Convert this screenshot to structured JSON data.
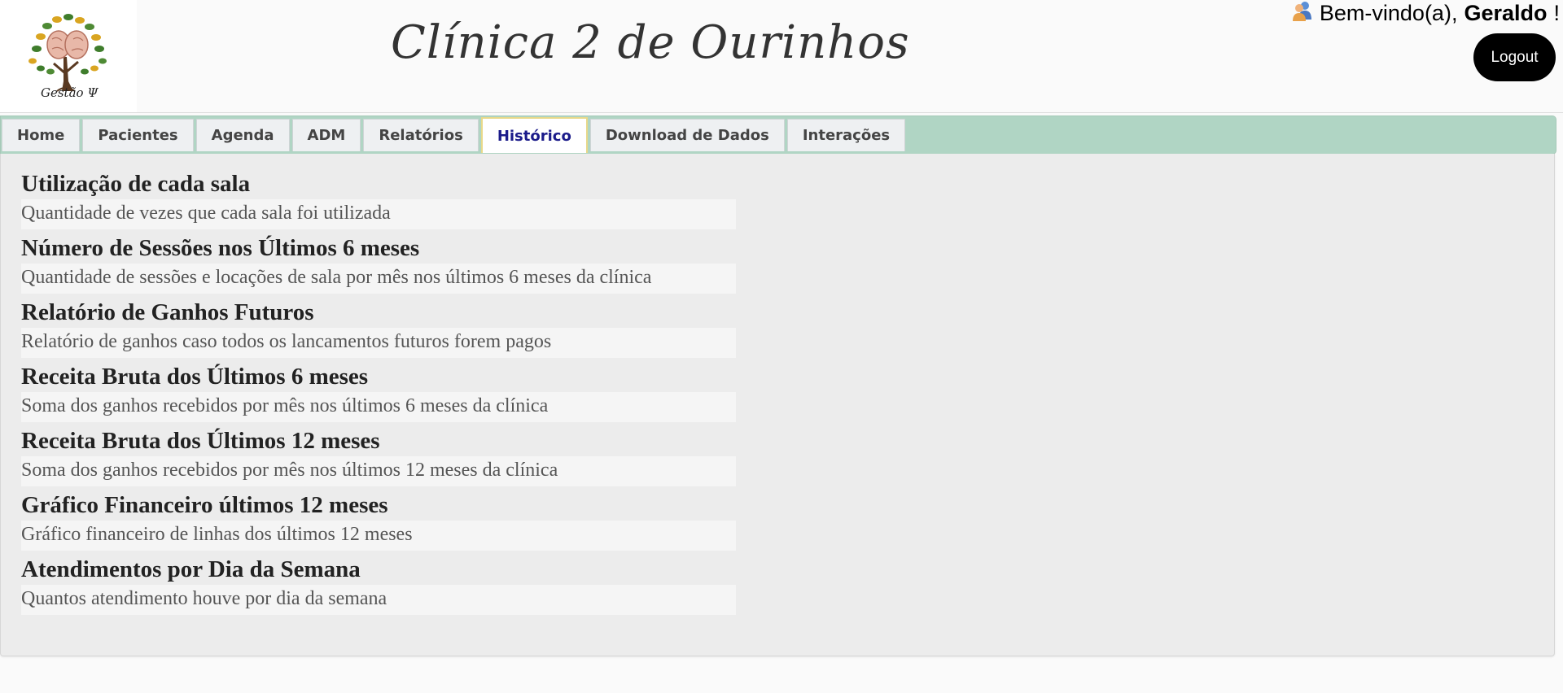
{
  "header": {
    "logo_text": "Gestão Ψ",
    "clinic_title": "Clínica 2 de Ourinhos",
    "welcome_prefix": "Bem-vindo(a),",
    "user_name": "Geraldo",
    "welcome_suffix": "!",
    "logout_label": "Logout"
  },
  "nav": {
    "tabs": [
      {
        "label": "Home"
      },
      {
        "label": "Pacientes"
      },
      {
        "label": "Agenda"
      },
      {
        "label": "ADM"
      },
      {
        "label": "Relatórios"
      },
      {
        "label": "Histórico",
        "active": true
      },
      {
        "label": "Download de Dados"
      },
      {
        "label": "Interações"
      }
    ]
  },
  "reports": [
    {
      "title": "Utilização de cada sala",
      "description": "Quantidade de vezes que cada sala foi utilizada"
    },
    {
      "title": "Número de Sessões nos Últimos 6 meses",
      "description": "Quantidade de sessões e locações de sala por mês nos últimos 6 meses da clínica"
    },
    {
      "title": "Relatório de Ganhos Futuros",
      "description": "Relatório de ganhos caso todos os lancamentos futuros forem pagos"
    },
    {
      "title": "Receita Bruta dos Últimos 6 meses",
      "description": "Soma dos ganhos recebidos por mês nos últimos 6 meses da clínica"
    },
    {
      "title": "Receita Bruta dos Últimos 12 meses",
      "description": "Soma dos ganhos recebidos por mês nos últimos 12 meses da clínica"
    },
    {
      "title": "Gráfico Financeiro últimos 12 meses",
      "description": "Gráfico financeiro de linhas dos últimos 12 meses"
    },
    {
      "title": "Atendimentos por Dia da Semana",
      "description": "Quantos atendimento houve por dia da semana"
    }
  ],
  "colors": {
    "tabbar_bg": "#b0d5c4",
    "active_tab_text": "#1b1b8a",
    "logout_bg": "#000000"
  },
  "icons": {
    "logo": "tree-brain-logo",
    "user": "users-icon"
  }
}
